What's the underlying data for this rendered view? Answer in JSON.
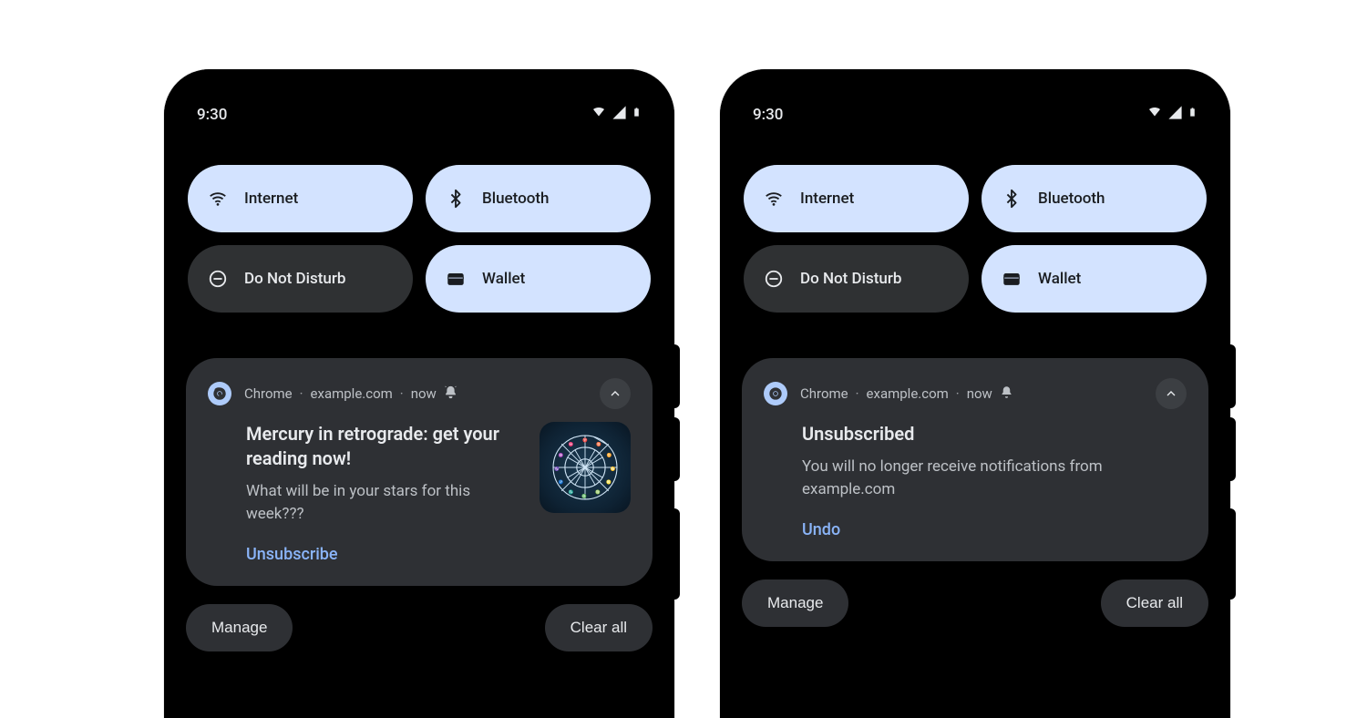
{
  "status": {
    "time": "9:30"
  },
  "tiles": {
    "internet": {
      "label": "Internet",
      "on": true
    },
    "bluetooth": {
      "label": "Bluetooth",
      "on": true
    },
    "dnd": {
      "label": "Do Not Disturb",
      "on": false
    },
    "wallet": {
      "label": "Wallet",
      "on": true
    }
  },
  "notifA": {
    "app": "Chrome",
    "site": "example.com",
    "time": "now",
    "title": "Mercury in retrograde: get your reading now!",
    "desc": "What will be in your stars for this week???",
    "action": "Unsubscribe"
  },
  "notifB": {
    "app": "Chrome",
    "site": "example.com",
    "time": "now",
    "title": "Unsubscribed",
    "desc": "You will no longer receive notifications from example.com",
    "action": "Undo"
  },
  "footer": {
    "manage": "Manage",
    "clear": "Clear all"
  },
  "colors": {
    "accent": "#8ab4f8",
    "tileOn": "#d3e3ff",
    "tileOff": "#2f3133",
    "card": "#2e3034"
  }
}
